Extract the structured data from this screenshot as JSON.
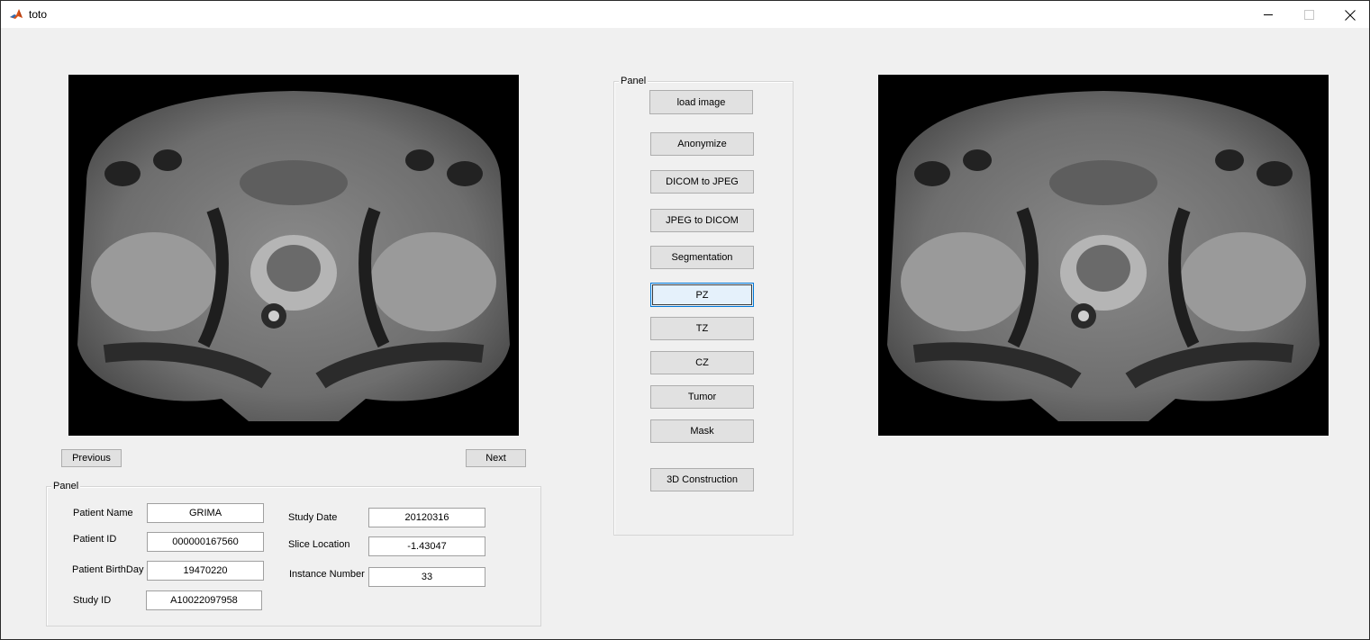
{
  "window": {
    "title": "toto",
    "app_icon": "matlab-icon",
    "controls": [
      "minimize-icon",
      "maximize-icon",
      "close-icon"
    ]
  },
  "images": {
    "left_alt": "axial MRI slice",
    "right_alt": "axial MRI slice"
  },
  "navigation": {
    "previous_label": "Previous",
    "next_label": "Next"
  },
  "control_panel": {
    "title": "Panel",
    "buttons": {
      "load_image": "load image",
      "anonymize": "Anonymize",
      "dicom_to_jpeg": "DICOM to JPEG",
      "jpeg_to_dicom": "JPEG to DICOM",
      "segmentation": "Segmentation",
      "pz": "PZ",
      "tz": "TZ",
      "cz": "CZ",
      "tumor": "Tumor",
      "mask": "Mask",
      "construction_3d": "3D Construction"
    }
  },
  "info_panel": {
    "title": "Panel",
    "patient_name_label": "Patient Name",
    "patient_name": "GRIMA",
    "patient_id_label": "Patient ID",
    "patient_id": "000000167560",
    "patient_birthday_label": "Patient BirthDay",
    "patient_birthday": "19470220",
    "study_id_label": "Study ID",
    "study_id": "A10022097958",
    "study_date_label": "Study Date",
    "study_date": "20120316",
    "slice_location_label": "Slice Location",
    "slice_location": "-1.43047",
    "instance_number_label": "Instance Number",
    "instance_number": "33"
  },
  "colors": {
    "window_bg": "#f0f0f0",
    "button_bg": "#e1e1e1",
    "focus_border": "#0078d7"
  }
}
